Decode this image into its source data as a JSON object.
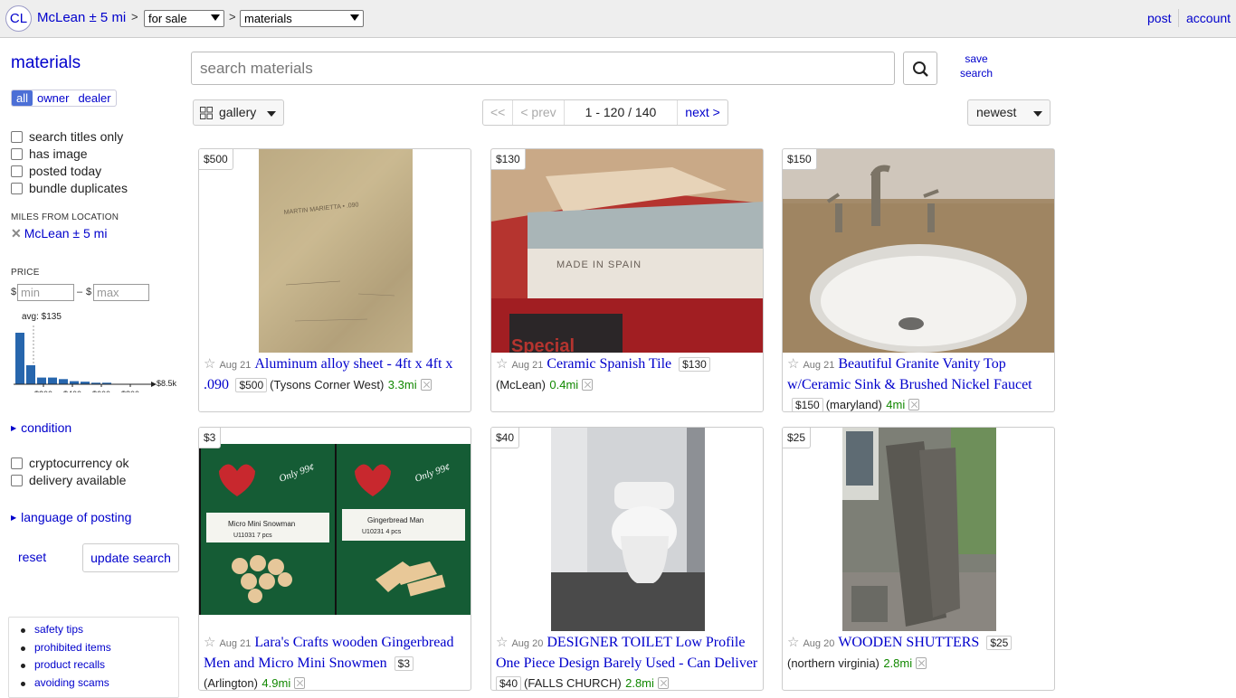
{
  "header": {
    "logo": "CL",
    "location": "McLean ± 5 mi",
    "sep": ">",
    "type_select": "for sale",
    "category_select": "materials",
    "post": "post",
    "account": "account"
  },
  "sidebar": {
    "title": "materials",
    "seller_filter": [
      "all",
      "owner",
      "dealer"
    ],
    "checks": [
      "search titles only",
      "has image",
      "posted today",
      "bundle duplicates"
    ],
    "miles_heading": "MILES FROM LOCATION",
    "miles_location": "McLean ± 5 mi",
    "price_heading": "PRICE",
    "min_placeholder": "min",
    "max_placeholder": "max",
    "currency": "$",
    "dash": "–",
    "histogram": {
      "avg_label": "avg: $135",
      "bar_heights": [
        1.0,
        0.37,
        0.13,
        0.13,
        0.1,
        0.06,
        0.05,
        0.03,
        0.03
      ],
      "tick_labels": [
        "$200",
        "$400",
        "$600",
        "$800"
      ],
      "max_label": "$8.5k",
      "bar_color": "#2766ad"
    },
    "condition": "condition",
    "checks2": [
      "cryptocurrency ok",
      "delivery available"
    ],
    "language": "language of posting",
    "reset": "reset",
    "update": "update search",
    "links": [
      "safety tips",
      "prohibited items",
      "product recalls",
      "avoiding scams"
    ]
  },
  "search": {
    "placeholder": "search materials",
    "save": "save search"
  },
  "toolbar": {
    "view": "gallery",
    "pager_first": "<<",
    "pager_prev": "< prev",
    "pager_range": "1 - 120 / 140",
    "pager_next": "next >",
    "sort": "newest"
  },
  "listings": [
    {
      "price": "$500",
      "date": "Aug 21",
      "title": "Aluminum alloy sheet - 4ft x 4ft x .090",
      "inline_price": "$500",
      "hood": "(Tysons Corner West)",
      "dist": "3.3mi"
    },
    {
      "price": "$130",
      "date": "Aug 21",
      "title": "Ceramic Spanish Tile",
      "inline_price": "$130",
      "hood": "(McLean)",
      "dist": "0.4mi"
    },
    {
      "price": "$150",
      "date": "Aug 21",
      "title": "Beautiful Granite Vanity Top w/Ceramic Sink & Brushed Nickel Faucet",
      "inline_price": "$150",
      "hood": "(maryland)",
      "dist": "4mi"
    },
    {
      "price": "$3",
      "date": "Aug 21",
      "title": "Lara's Crafts wooden Gingerbread Men and Micro Mini Snowmen",
      "inline_price": "$3",
      "hood": "(Arlington)",
      "dist": "4.9mi"
    },
    {
      "price": "$40",
      "date": "Aug 20",
      "title": "DESIGNER TOILET Low Profile One Piece Design Barely Used - Can Deliver",
      "inline_price": "$40",
      "hood": "(FALLS CHURCH)",
      "dist": "2.8mi"
    },
    {
      "price": "$25",
      "date": "Aug 20",
      "title": "WOODEN SHUTTERS",
      "inline_price": "$25",
      "hood": "(northern virginia)",
      "dist": "2.8mi"
    }
  ],
  "photo_text": {
    "tile_stamp": "MADE IN SPAIN",
    "tile_box": "Special",
    "sheet_mark": "MARTIN MARIETTA • .090",
    "craft_brand": "Lara's Crafts",
    "craft_price": "Only 99¢",
    "craft_left_name": "Micro Mini Snowman",
    "craft_left_code": "U11031     7  pcs",
    "craft_right_name": "Gingerbread Man",
    "craft_right_code": "U10231     4    pcs"
  }
}
